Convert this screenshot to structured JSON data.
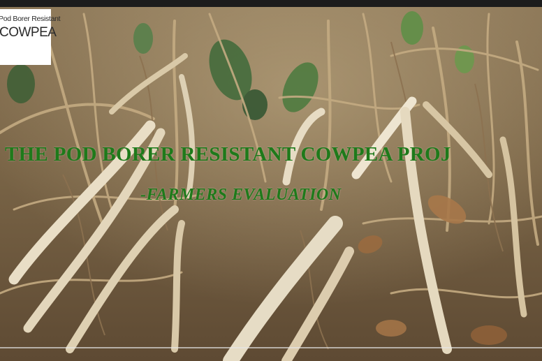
{
  "logo": {
    "line1": "Pod Borer Resistant",
    "line2": "COWPEA"
  },
  "caption": {
    "title": "THE POD BORER RESISTANT COWPEA PROJ",
    "subtitle": "-FARMERS EVALUATION"
  }
}
